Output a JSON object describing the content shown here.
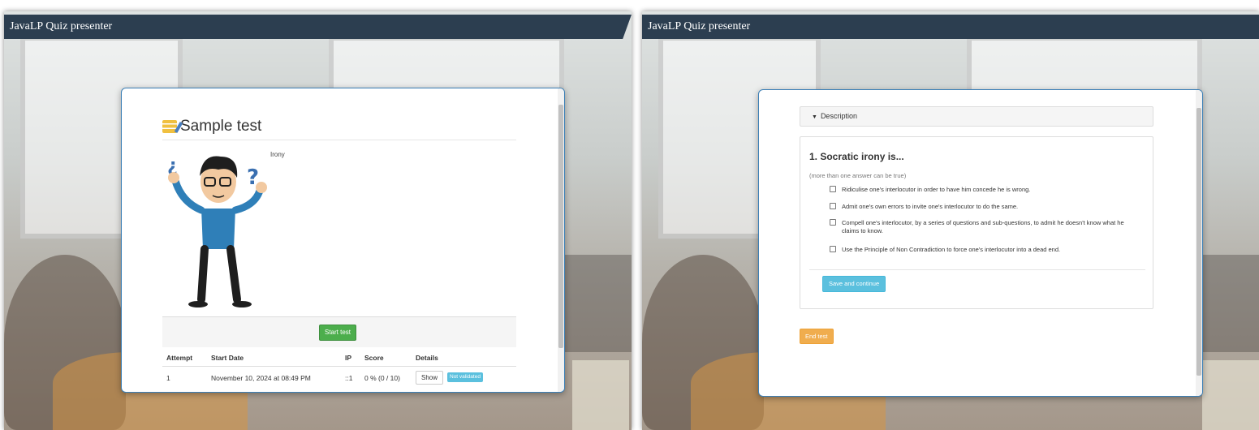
{
  "windows": [
    {
      "title": "JavaLP Quiz presenter",
      "quiz": {
        "title": "Sample test",
        "illustration_caption": "Irony",
        "start_button": "Start test",
        "attempts_table": {
          "headers": [
            "Attempt",
            "Start Date",
            "IP",
            "Score",
            "Details"
          ],
          "rows": [
            {
              "attempt": "1",
              "start_date": "November 10, 2024 at 08:49 PM",
              "ip": "::1",
              "score": "0 % (0 / 10)",
              "show_button": "Show",
              "status_badge": "Not validated"
            }
          ]
        }
      }
    },
    {
      "title": "JavaLP Quiz presenter",
      "question_view": {
        "description_toggle": "Description",
        "question_title": "1. Socratic irony is...",
        "hint": "(more than one answer can be true)",
        "options": [
          "Ridiculise one's interlocutor in order to have him concede he is wrong.",
          "Admit one's own errors to invite one's interlocutor to do the same.",
          "Compell one's interlocutor, by a series of questions and sub-questions, to admit he doesn't know what he claims to know.",
          "Use the Principle of Non Contradiction to force one's interlocutor into a dead end."
        ],
        "save_button": "Save and continue",
        "end_button": "End test"
      }
    }
  ],
  "colors": {
    "titlebar": "#2c3e50",
    "panel_border": "#3b7fb6",
    "start_button": "#4cae4c",
    "info_button": "#5bc0de",
    "end_button": "#f0ad4e"
  }
}
